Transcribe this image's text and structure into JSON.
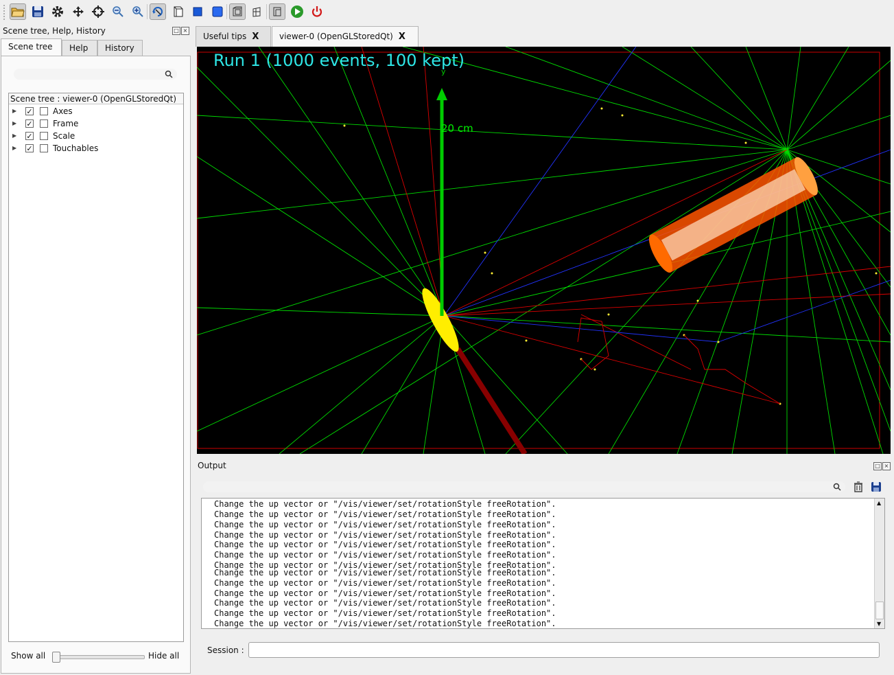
{
  "toolbar": {
    "icons": [
      "open-folder-icon",
      "save-icon",
      "settings-gear-icon",
      "move-icon",
      "pick-target-icon",
      "zoom-out-icon",
      "zoom-in-icon",
      "rotate-icon",
      "wireframe-icon",
      "solid-icon",
      "surface-icon",
      "perspective-icon",
      "ortho-icon",
      "hidden-line-icon",
      "run-icon",
      "power-icon"
    ]
  },
  "left_dock": {
    "title": "Scene tree, Help, History",
    "tabs": [
      "Scene tree",
      "Help",
      "History"
    ],
    "tree_header": "Scene tree : viewer-0 (OpenGLStoredQt)",
    "items": [
      {
        "label": "Axes",
        "checked": true
      },
      {
        "label": "Frame",
        "checked": true
      },
      {
        "label": "Scale",
        "checked": true
      },
      {
        "label": "Touchables",
        "checked": true
      }
    ],
    "show_all": "Show all",
    "hide_all": "Hide all",
    "slider_value": 0
  },
  "viewer_tabs": [
    {
      "label": "Useful tips",
      "close": "X"
    },
    {
      "label": "viewer-0 (OpenGLStoredQt)",
      "close": "X"
    }
  ],
  "viewer": {
    "run_title": "Run 1 (1000 events, 100 kept)",
    "scale_label": "20 cm",
    "axis_label": "y"
  },
  "output": {
    "title": "Output",
    "lines": [
      "Change the up vector or \"/vis/viewer/set/rotationStyle freeRotation\".",
      "Change the up vector or \"/vis/viewer/set/rotationStyle freeRotation\".",
      "Change the up vector or \"/vis/viewer/set/rotationStyle freeRotation\".",
      "Change the up vector or \"/vis/viewer/set/rotationStyle freeRotation\".",
      "Change the up vector or \"/vis/viewer/set/rotationStyle freeRotation\".",
      "Change the up vector or \"/vis/viewer/set/rotationStyle freeRotation\".",
      "Change the up vector or \"/vis/viewer/set/rotationStyle freeRotation\".",
      "Change the up vector or \"/vis/viewer/set/rotationStyle freeRotation\".",
      "Change the up vector or \"/vis/viewer/set/rotationStyle freeRotation\".",
      "Change the up vector or \"/vis/viewer/set/rotationStyle freeRotation\".",
      "Change the up vector or \"/vis/viewer/set/rotationStyle freeRotation\".",
      "Change the up vector or \"/vis/viewer/set/rotationStyle freeRotation\".",
      "Change the up vector or \"/vis/viewer/set/rotationStyle freeRotation\"."
    ],
    "session_label": "Session :"
  },
  "colors": {
    "title_cyan": "#2ee6e6",
    "track_green": "#00ee00",
    "track_red": "#dd0000",
    "track_blue": "#2233ff",
    "detector_yellow": "#ffee00",
    "detector_orange": "#ff5500"
  }
}
